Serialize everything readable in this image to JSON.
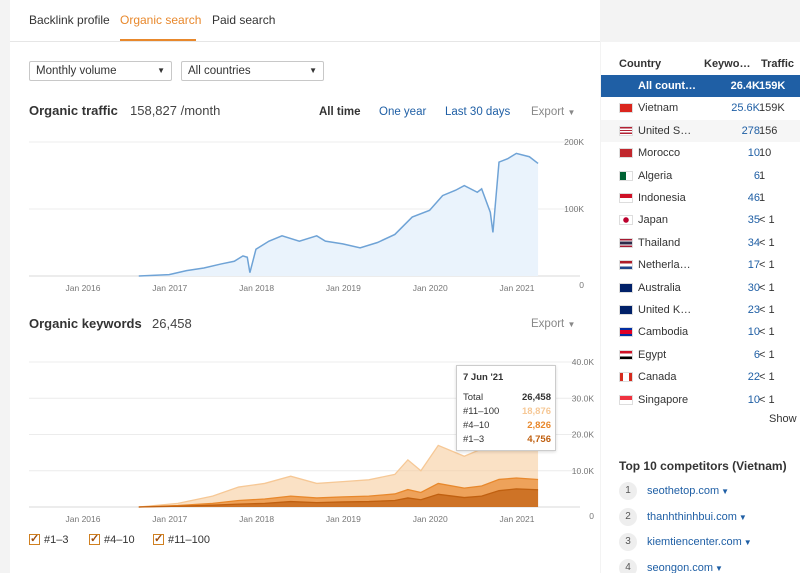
{
  "tabs": [
    {
      "label": "Backlink profile"
    },
    {
      "label": "Organic search"
    },
    {
      "label": "Paid search"
    }
  ],
  "filters": {
    "volume": "Monthly volume",
    "country": "All countries"
  },
  "traffic": {
    "title": "Organic traffic",
    "value": "158,827 /month",
    "ranges": [
      "All time",
      "One year",
      "Last 30 days"
    ],
    "export": "Export"
  },
  "keywords": {
    "title": "Organic keywords",
    "value": "26,458",
    "export": "Export"
  },
  "tooltip": {
    "date": "7 Jun '21",
    "rows": [
      {
        "label": "Total",
        "value": "26,458",
        "color": "#333333"
      },
      {
        "label": "#11–100",
        "value": "18,876",
        "color": "#f6c896"
      },
      {
        "label": "#4–10",
        "value": "2,826",
        "color": "#e8882c"
      },
      {
        "label": "#1–3",
        "value": "4,756",
        "color": "#c06010"
      }
    ]
  },
  "legend": [
    "#1–3",
    "#4–10",
    "#11–100"
  ],
  "chart_data": [
    {
      "type": "area",
      "title": "Organic traffic",
      "x_ticks": [
        "Jan 2016",
        "Jan 2017",
        "Jan 2018",
        "Jan 2019",
        "Jan 2020",
        "Jan 2021"
      ],
      "y_ticks": [
        "0",
        "100K",
        "200K"
      ],
      "ylim": [
        0,
        200000
      ],
      "color": "#6fa3d6",
      "fill": "#eaf3fc",
      "x": [
        2016.85,
        2017.2,
        2017.4,
        2017.6,
        2017.8,
        2017.95,
        2018.05,
        2018.1,
        2018.13,
        2018.2,
        2018.35,
        2018.5,
        2018.7,
        2018.9,
        2019.0,
        2019.2,
        2019.4,
        2019.6,
        2019.8,
        2020.0,
        2020.2,
        2020.35,
        2020.5,
        2020.6,
        2020.75,
        2020.8,
        2020.9,
        2020.93,
        2021.0,
        2021.1,
        2021.2,
        2021.35,
        2021.45
      ],
      "y": [
        0,
        2000,
        8000,
        12000,
        18000,
        22000,
        30000,
        28000,
        5000,
        40000,
        52000,
        60000,
        52000,
        60000,
        52000,
        48000,
        42000,
        50000,
        62000,
        88000,
        98000,
        120000,
        128000,
        135000,
        125000,
        130000,
        95000,
        65000,
        170000,
        175000,
        183000,
        178000,
        168000
      ]
    },
    {
      "type": "area",
      "title": "Organic keywords",
      "x_ticks": [
        "Jan 2016",
        "Jan 2017",
        "Jan 2018",
        "Jan 2019",
        "Jan 2020",
        "Jan 2021"
      ],
      "y_ticks": [
        "0",
        "10.0K",
        "20.0K",
        "30.0K",
        "40.0K"
      ],
      "ylim": [
        0,
        40000
      ],
      "x": [
        2016.85,
        2017.3,
        2017.7,
        2018.0,
        2018.3,
        2018.6,
        2018.9,
        2019.2,
        2019.5,
        2019.8,
        2019.95,
        2020.1,
        2020.3,
        2020.6,
        2020.8,
        2021.0,
        2021.2,
        2021.45
      ],
      "series": [
        {
          "name": "#1–3",
          "color": "#c06010",
          "values": [
            0,
            200,
            500,
            800,
            1000,
            1500,
            1200,
            1400,
            1500,
            1800,
            2500,
            2000,
            3500,
            2600,
            3000,
            4500,
            5000,
            4756
          ]
        },
        {
          "name": "#4–10",
          "color": "#e8882c",
          "values": [
            0,
            400,
            1000,
            1800,
            2200,
            3000,
            2500,
            2800,
            3000,
            3600,
            4800,
            4000,
            6500,
            5200,
            5800,
            7600,
            8000,
            7582
          ]
        },
        {
          "name": "#11–100",
          "color": "#f6c896",
          "values": [
            0,
            1000,
            3000,
            5500,
            6500,
            8500,
            6500,
            7000,
            7500,
            9000,
            13000,
            10000,
            17000,
            14000,
            16000,
            25000,
            30000,
            26458
          ]
        }
      ]
    }
  ],
  "countries": {
    "headers": [
      "Country",
      "Keywo…",
      "Traffic"
    ],
    "rows": [
      {
        "name": "All count…",
        "kw": "26.4K",
        "traffic": "159K",
        "flag": "none"
      },
      {
        "name": "Vietnam",
        "kw": "25.6K",
        "traffic": "159K",
        "flag": "vn"
      },
      {
        "name": "United S…",
        "kw": "278",
        "traffic": "156",
        "flag": "us"
      },
      {
        "name": "Morocco",
        "kw": "10",
        "traffic": "10",
        "flag": "ma"
      },
      {
        "name": "Algeria",
        "kw": "6",
        "traffic": "1",
        "flag": "dz"
      },
      {
        "name": "Indonesia",
        "kw": "46",
        "traffic": "1",
        "flag": "id"
      },
      {
        "name": "Japan",
        "kw": "35",
        "traffic": "< 1",
        "flag": "jp"
      },
      {
        "name": "Thailand",
        "kw": "34",
        "traffic": "< 1",
        "flag": "th"
      },
      {
        "name": "Netherla…",
        "kw": "17",
        "traffic": "< 1",
        "flag": "nl"
      },
      {
        "name": "Australia",
        "kw": "30",
        "traffic": "< 1",
        "flag": "au"
      },
      {
        "name": "United K…",
        "kw": "23",
        "traffic": "< 1",
        "flag": "gb"
      },
      {
        "name": "Cambodia",
        "kw": "10",
        "traffic": "< 1",
        "flag": "kh"
      },
      {
        "name": "Egypt",
        "kw": "6",
        "traffic": "< 1",
        "flag": "eg"
      },
      {
        "name": "Canada",
        "kw": "22",
        "traffic": "< 1",
        "flag": "ca"
      },
      {
        "name": "Singapore",
        "kw": "10",
        "traffic": "< 1",
        "flag": "sg"
      }
    ],
    "show_more": "Show"
  },
  "competitors": {
    "title": "Top 10 competitors (Vietnam)",
    "items": [
      {
        "rank": "1",
        "domain": "seothetop.com"
      },
      {
        "rank": "2",
        "domain": "thanhthinhbui.com"
      },
      {
        "rank": "3",
        "domain": "kiemtiencenter.com"
      },
      {
        "rank": "4",
        "domain": "seongon.com"
      }
    ]
  }
}
